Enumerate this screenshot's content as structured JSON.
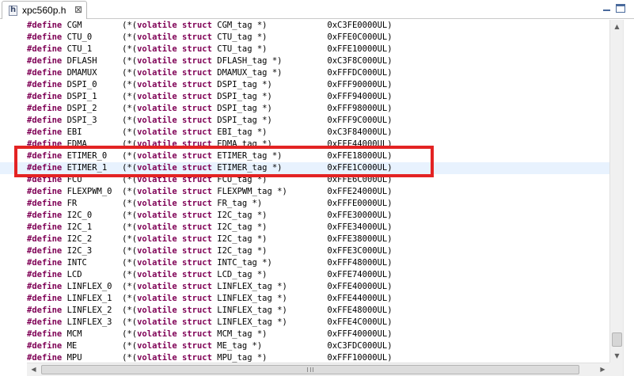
{
  "tab": {
    "filename": "xpc560p.h",
    "close_glyph": "⊠",
    "icon_letter": "h"
  },
  "colors": {
    "keyword": "#7f0055",
    "highlight_box": "#e32323",
    "current_line": "#e8f2fe"
  },
  "keywords": [
    "#define",
    "volatile",
    "struct"
  ],
  "editor": {
    "current_line_index": 12,
    "highlighted_lines": [
      11,
      12
    ],
    "lines": [
      {
        "name": "CGM",
        "tag": "CGM_tag",
        "address": "0xC3FE0000UL"
      },
      {
        "name": "CTU_0",
        "tag": "CTU_tag",
        "address": "0xFFE0C000UL"
      },
      {
        "name": "CTU_1",
        "tag": "CTU_tag",
        "address": "0xFFE10000UL"
      },
      {
        "name": "DFLASH",
        "tag": "DFLASH_tag",
        "address": "0xC3F8C000UL"
      },
      {
        "name": "DMAMUX",
        "tag": "DMAMUX_tag",
        "address": "0xFFFDC000UL"
      },
      {
        "name": "DSPI_0",
        "tag": "DSPI_tag",
        "address": "0xFFF90000UL"
      },
      {
        "name": "DSPI_1",
        "tag": "DSPI_tag",
        "address": "0xFFF94000UL"
      },
      {
        "name": "DSPI_2",
        "tag": "DSPI_tag",
        "address": "0xFFF98000UL"
      },
      {
        "name": "DSPI_3",
        "tag": "DSPI_tag",
        "address": "0xFFF9C000UL"
      },
      {
        "name": "EBI",
        "tag": "EBI_tag",
        "address": "0xC3F84000UL"
      },
      {
        "name": "EDMA",
        "tag": "EDMA_tag",
        "address": "0xFFF44000UL"
      },
      {
        "name": "ETIMER_0",
        "tag": "ETIMER_tag",
        "address": "0xFFE18000UL"
      },
      {
        "name": "ETIMER_1",
        "tag": "ETIMER_tag",
        "address": "0xFFE1C000UL"
      },
      {
        "name": "FCU",
        "tag": "FCU_tag",
        "address": "0xFFE6C000UL"
      },
      {
        "name": "FLEXPWM_0",
        "tag": "FLEXPWM_tag",
        "address": "0xFFE24000UL"
      },
      {
        "name": "FR",
        "tag": "FR_tag",
        "address": "0xFFFE0000UL"
      },
      {
        "name": "I2C_0",
        "tag": "I2C_tag",
        "address": "0xFFE30000UL"
      },
      {
        "name": "I2C_1",
        "tag": "I2C_tag",
        "address": "0xFFE34000UL"
      },
      {
        "name": "I2C_2",
        "tag": "I2C_tag",
        "address": "0xFFE38000UL"
      },
      {
        "name": "I2C_3",
        "tag": "I2C_tag",
        "address": "0xFFE3C000UL"
      },
      {
        "name": "INTC",
        "tag": "INTC_tag",
        "address": "0xFFF48000UL"
      },
      {
        "name": "LCD",
        "tag": "LCD_tag",
        "address": "0xFFE74000UL"
      },
      {
        "name": "LINFLEX_0",
        "tag": "LINFLEX_tag",
        "address": "0xFFE40000UL"
      },
      {
        "name": "LINFLEX_1",
        "tag": "LINFLEX_tag",
        "address": "0xFFE44000UL"
      },
      {
        "name": "LINFLEX_2",
        "tag": "LINFLEX_tag",
        "address": "0xFFE48000UL"
      },
      {
        "name": "LINFLEX_3",
        "tag": "LINFLEX_tag",
        "address": "0xFFE4C000UL"
      },
      {
        "name": "MCM",
        "tag": "MCM_tag",
        "address": "0xFFF40000UL"
      },
      {
        "name": "ME",
        "tag": "ME_tag",
        "address": "0xC3FDC000UL"
      },
      {
        "name": "MPU",
        "tag": "MPU_tag",
        "address": "0xFFF10000UL"
      }
    ]
  }
}
